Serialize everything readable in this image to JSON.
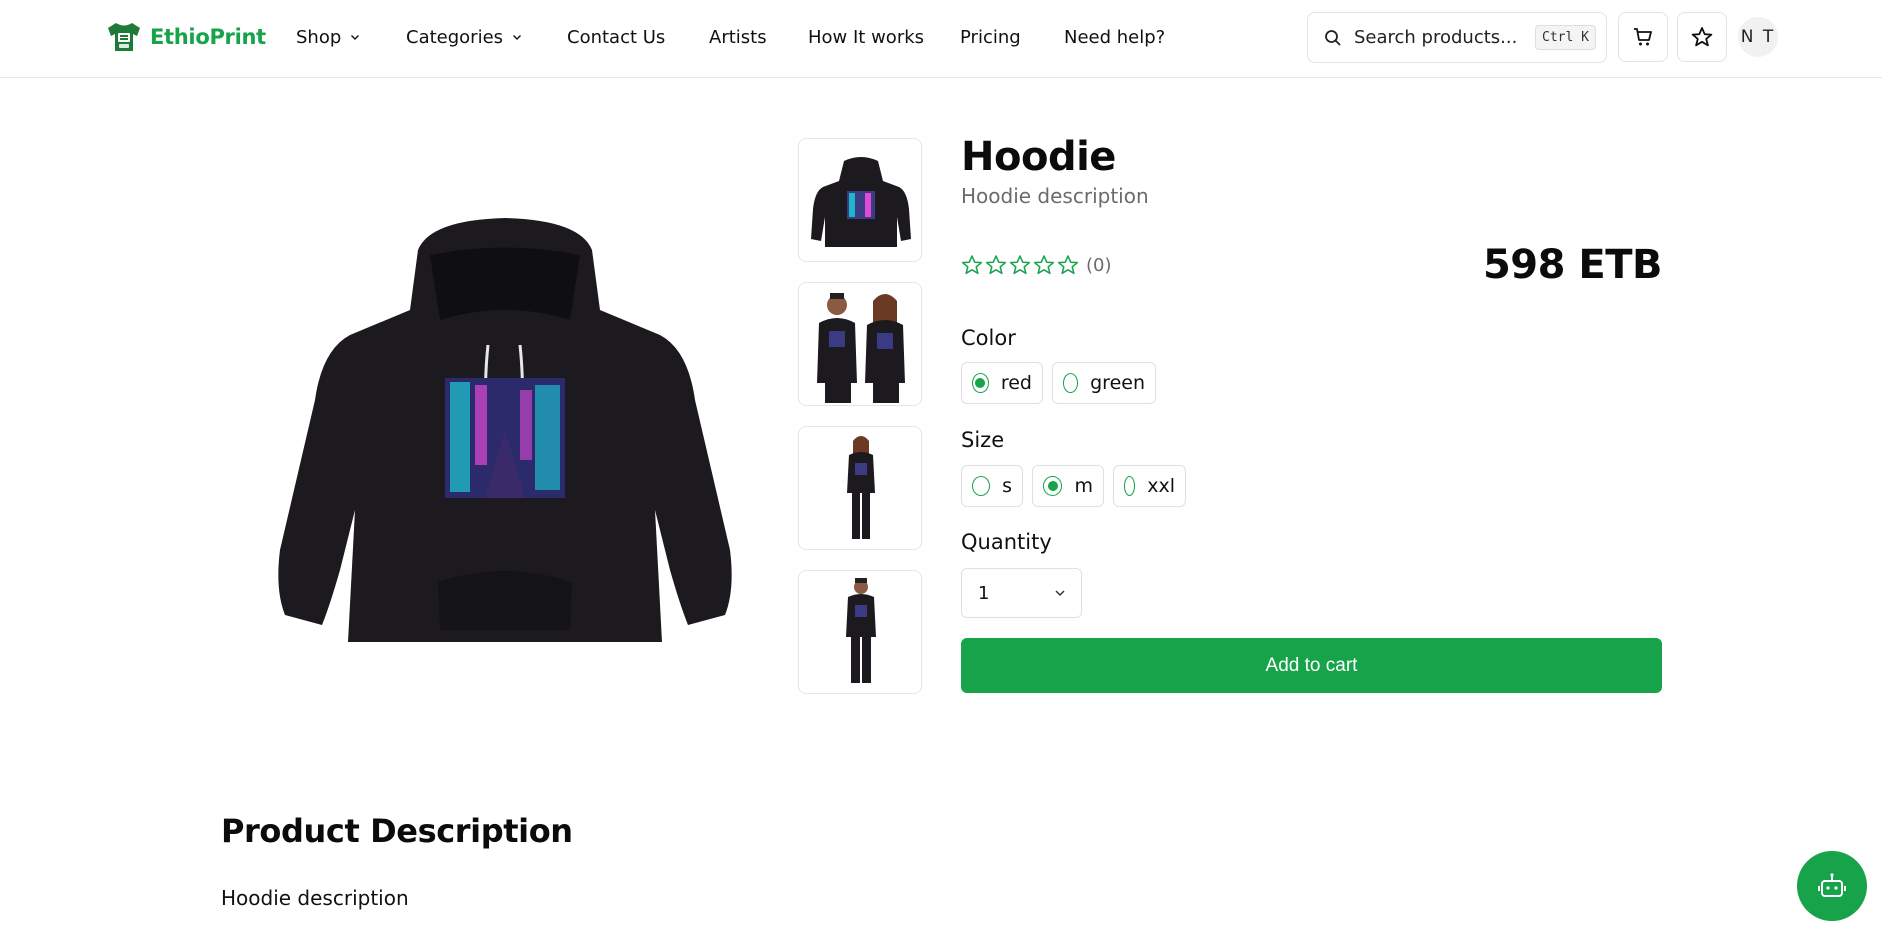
{
  "brand": {
    "name": "EthioPrint",
    "logo_icon": "tshirt-logo-icon",
    "color": "#16a34a"
  },
  "nav": {
    "shop": "Shop",
    "categories": "Categories",
    "contact": "Contact Us",
    "artists": "Artists",
    "how": "How It works",
    "pricing": "Pricing",
    "help": "Need help?"
  },
  "search": {
    "placeholder": "Search products...",
    "shortcut": "Ctrl K",
    "icon": "search-icon"
  },
  "header_icons": {
    "cart": "cart-icon",
    "wishlist": "star-icon"
  },
  "user": {
    "initials": "N T"
  },
  "product": {
    "title": "Hoodie",
    "subtitle": "Hoodie description",
    "rating": 0,
    "rating_max": 5,
    "review_count": "(0)",
    "price": "598 ETB",
    "thumbnails": [
      "hoodie-front",
      "couple-wearing-hoodies",
      "woman-full-outfit",
      "man-full-outfit"
    ]
  },
  "options": {
    "color_label": "Color",
    "colors": [
      {
        "label": "red",
        "selected": true
      },
      {
        "label": "green",
        "selected": false
      }
    ],
    "size_label": "Size",
    "sizes": [
      {
        "label": "s",
        "selected": false
      },
      {
        "label": "m",
        "selected": true
      },
      {
        "label": "xxl",
        "selected": false
      }
    ],
    "quantity_label": "Quantity",
    "quantity_value": "1"
  },
  "actions": {
    "add_to_cart": "Add to cart"
  },
  "description": {
    "heading": "Product Description",
    "text": "Hoodie description"
  },
  "chat": {
    "icon": "robot-icon"
  }
}
